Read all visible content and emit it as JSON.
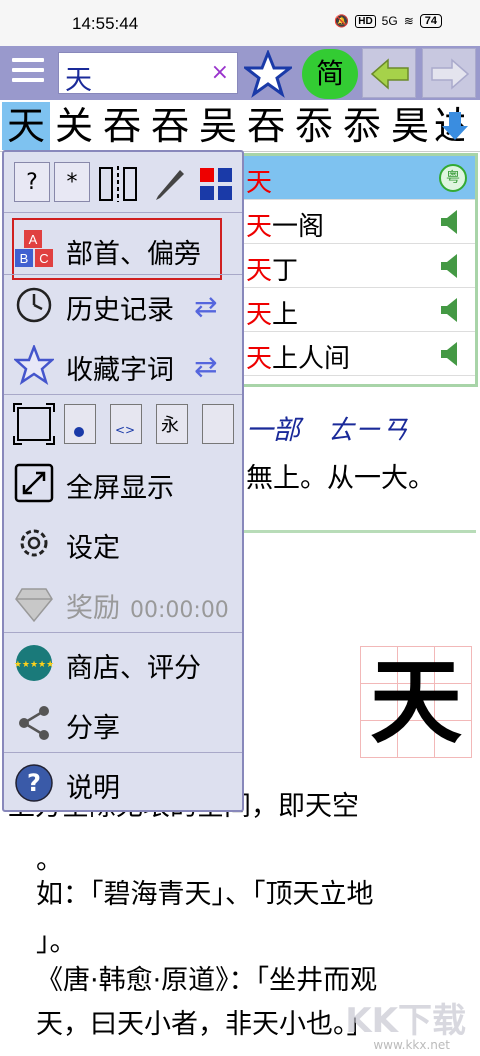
{
  "status_bar": {
    "time": "14:55:44",
    "hd": "HD",
    "network": "5G",
    "battery": "74"
  },
  "toolbar": {
    "search_value": "天",
    "clear": "×",
    "simplified_label": "简"
  },
  "strip": {
    "chars": [
      "天",
      "关",
      "吞",
      "吞",
      "吴",
      "吞",
      "忝",
      "忝",
      "昊",
      "达"
    ]
  },
  "word_list": [
    {
      "hl": "天",
      "rest": "",
      "badge": "粤"
    },
    {
      "hl": "天",
      "rest": "一阁"
    },
    {
      "hl": "天",
      "rest": "丁"
    },
    {
      "hl": "天",
      "rest": "上"
    },
    {
      "hl": "天",
      "rest": "上人间"
    }
  ],
  "content": {
    "pinyin": "一部　ㄊㄧㄢ",
    "def1": "無上。从一大。",
    "big_char": "天",
    "lines": [
      "上方空際无垠的空间，即天空",
      "。",
      "如：「碧海青天」、「顶天立地",
      "」。",
      "《唐·韩愈·原道》：「坐井而观",
      "天，曰天小者，非天小也。」"
    ]
  },
  "menu": {
    "top_buttons": [
      "?",
      "*"
    ],
    "items": {
      "radicals": "部首、偏旁",
      "history": "历史记录",
      "favorites": "收藏字词",
      "fullscreen": "全屏显示",
      "settings": "设定",
      "reward": "奖励",
      "reward_timer": "00:00:00",
      "store": "商店、评分",
      "share": "分享",
      "help": "说明"
    },
    "view_button_glyph": "永"
  },
  "watermark": {
    "text": "KK下载",
    "url": "www.kkx.net"
  }
}
